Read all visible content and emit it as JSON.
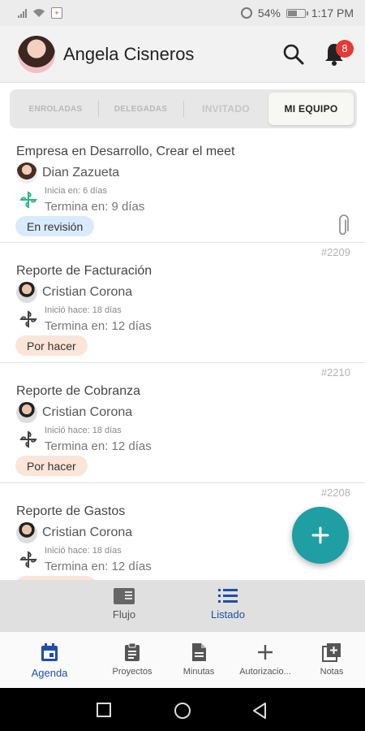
{
  "status_bar": {
    "battery": "54%",
    "time": "1:17 PM",
    "battery_level": 0.54
  },
  "header": {
    "user_name": "Angela Cisneros",
    "notification_count": "8"
  },
  "tabs": [
    {
      "label": "ENROLADAS",
      "active": false
    },
    {
      "label": "DELEGADAS",
      "active": false
    },
    {
      "label": "INVITADO",
      "active": false
    },
    {
      "label": "MI EQUIPO",
      "active": true
    }
  ],
  "tasks": [
    {
      "id": "",
      "title": "Empresa en Desarrollo, Crear el meet",
      "assignee": "Dian Zazueta",
      "start": "Inicia en: 6 días",
      "end": "Termina en: 9 días",
      "status": "En revisión",
      "status_kind": "review",
      "attachment": true,
      "icon_color": "#2bb58a"
    },
    {
      "id": "#2209",
      "title": "Reporte de Facturación",
      "assignee": "Cristian Corona",
      "start": "Inició hace: 18 días",
      "end": "Termina en: 12 días",
      "status": "Por hacer",
      "status_kind": "todo",
      "attachment": false,
      "icon_color": "#444444"
    },
    {
      "id": "#2210",
      "title": "Reporte de Cobranza",
      "assignee": "Cristian Corona",
      "start": "Inició hace: 18 días",
      "end": "Termina en: 12 días",
      "status": "Por hacer",
      "status_kind": "todo",
      "attachment": false,
      "icon_color": "#444444"
    },
    {
      "id": "#2208",
      "title": "Reporte de Gastos",
      "assignee": "Cristian Corona",
      "start": "Inició hace: 18 días",
      "end": "Termina en: 12 días",
      "status": "",
      "status_kind": "todo",
      "attachment": false,
      "icon_color": "#444444"
    }
  ],
  "view_toggle": {
    "flow_label": "Flujo",
    "list_label": "Listado",
    "active": "Listado"
  },
  "bottom_nav": [
    {
      "label": "Agenda",
      "icon": "calendar-icon",
      "active": true
    },
    {
      "label": "Proyectos",
      "icon": "clipboard-icon",
      "active": false
    },
    {
      "label": "Minutas",
      "icon": "document-icon",
      "active": false
    },
    {
      "label": "Autorizacio...",
      "icon": "plus-icon",
      "active": false
    },
    {
      "label": "Notas",
      "icon": "add-note-icon",
      "active": false
    }
  ],
  "colors": {
    "accent": "#1f9ea3",
    "active_blue": "#1e4fa8",
    "review_chip": "#d9ebfb",
    "todo_chip": "#fbe5d8"
  }
}
